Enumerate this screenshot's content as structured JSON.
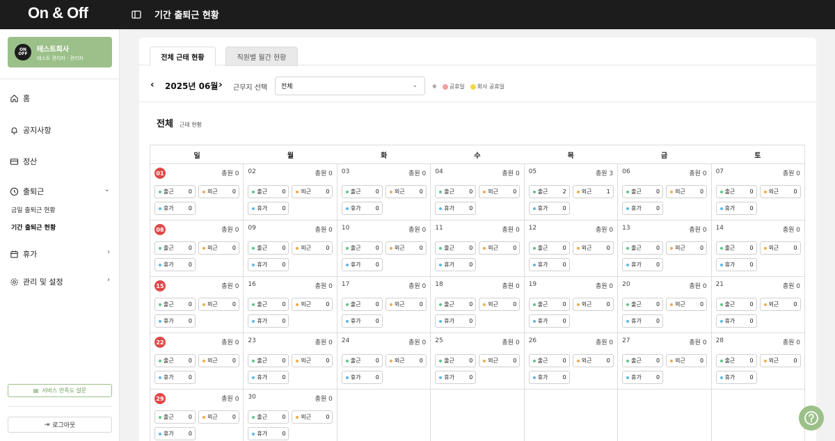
{
  "app": {
    "logo": "On & Off",
    "page_title": "기간 출퇴근 현황"
  },
  "sidebar": {
    "company": {
      "logo_text": "ON OFF",
      "name": "테스트회사",
      "sub": "테스트 관리자 · 관리자",
      "color": "#9bc089"
    },
    "items": [
      {
        "label": "홈",
        "icon": "home-icon"
      },
      {
        "label": "공지사항",
        "icon": "bell-icon"
      },
      {
        "label": "정산",
        "icon": "card-icon"
      },
      {
        "label": "출퇴근",
        "icon": "clock-icon"
      },
      {
        "label": "휴가",
        "icon": "calendar-icon"
      },
      {
        "label": "관리 및 설정",
        "icon": "gear-icon"
      }
    ],
    "sub_items": [
      {
        "label": "금일 출퇴근 현황"
      },
      {
        "label": "기간 출퇴근 현황"
      }
    ],
    "survey_label": "서비스 만족도 설문",
    "logout_label": "로그아웃"
  },
  "tabs": [
    {
      "label": "전체 근태 현황"
    },
    {
      "label": "직원별 월간 현황"
    }
  ],
  "toolbar": {
    "month": "2025년 06월",
    "site_label": "근무지 선택",
    "site_value": "전체",
    "legend_prefix": "※",
    "legend_public": "공휴일",
    "legend_company": "회사 공휴일",
    "public_color": "#f0a0a0",
    "company_color": "#f2d94a"
  },
  "section": {
    "title": "전체",
    "sub": "근태 현황"
  },
  "calendar": {
    "weekdays": [
      "일",
      "월",
      "화",
      "수",
      "목",
      "금",
      "토"
    ],
    "labels": {
      "total": "총원",
      "in": "출근",
      "out": "외근",
      "leave": "휴가"
    },
    "colors": {
      "in": "#5cc48a",
      "out": "#f2a94a",
      "leave": "#5bb8e8"
    },
    "days": [
      {
        "date": "01",
        "total": "0",
        "in": "0",
        "out": "0",
        "leave": "0",
        "holiday": true
      },
      {
        "date": "02",
        "total": "0",
        "in": "0",
        "out": "0",
        "leave": "0"
      },
      {
        "date": "03",
        "total": "0",
        "in": "0",
        "out": "0",
        "leave": "0"
      },
      {
        "date": "04",
        "total": "0",
        "in": "0",
        "out": "0",
        "leave": "0"
      },
      {
        "date": "05",
        "total": "3",
        "in": "2",
        "out": "1",
        "leave": "0"
      },
      {
        "date": "06",
        "total": "0",
        "in": "0",
        "out": "0",
        "leave": "0"
      },
      {
        "date": "07",
        "total": "0",
        "in": "0",
        "out": "0",
        "leave": "0"
      },
      {
        "date": "08",
        "total": "0",
        "in": "0",
        "out": "0",
        "leave": "0",
        "holiday": true
      },
      {
        "date": "09",
        "total": "0",
        "in": "0",
        "out": "0",
        "leave": "0"
      },
      {
        "date": "10",
        "total": "0",
        "in": "0",
        "out": "0",
        "leave": "0"
      },
      {
        "date": "11",
        "total": "0",
        "in": "0",
        "out": "0",
        "leave": "0"
      },
      {
        "date": "12",
        "total": "0",
        "in": "0",
        "out": "0",
        "leave": "0"
      },
      {
        "date": "13",
        "total": "0",
        "in": "0",
        "out": "0",
        "leave": "0"
      },
      {
        "date": "14",
        "total": "0",
        "in": "0",
        "out": "0",
        "leave": "0"
      },
      {
        "date": "15",
        "total": "0",
        "in": "0",
        "out": "0",
        "leave": "0",
        "holiday": true
      },
      {
        "date": "16",
        "total": "0",
        "in": "0",
        "out": "0",
        "leave": "0"
      },
      {
        "date": "17",
        "total": "0",
        "in": "0",
        "out": "0",
        "leave": "0"
      },
      {
        "date": "18",
        "total": "0",
        "in": "0",
        "out": "0",
        "leave": "0"
      },
      {
        "date": "19",
        "total": "0",
        "in": "0",
        "out": "0",
        "leave": "0"
      },
      {
        "date": "20",
        "total": "0",
        "in": "0",
        "out": "0",
        "leave": "0"
      },
      {
        "date": "21",
        "total": "0",
        "in": "0",
        "out": "0",
        "leave": "0"
      },
      {
        "date": "22",
        "total": "0",
        "in": "0",
        "out": "0",
        "leave": "0",
        "holiday": true
      },
      {
        "date": "23",
        "total": "0",
        "in": "0",
        "out": "0",
        "leave": "0"
      },
      {
        "date": "24",
        "total": "0",
        "in": "0",
        "out": "0",
        "leave": "0"
      },
      {
        "date": "25",
        "total": "0",
        "in": "0",
        "out": "0",
        "leave": "0"
      },
      {
        "date": "26",
        "total": "0",
        "in": "0",
        "out": "0",
        "leave": "0"
      },
      {
        "date": "27",
        "total": "0",
        "in": "0",
        "out": "0",
        "leave": "0"
      },
      {
        "date": "28",
        "total": "0",
        "in": "0",
        "out": "0",
        "leave": "0"
      },
      {
        "date": "29",
        "total": "0",
        "in": "0",
        "out": "0",
        "leave": "0",
        "holiday": true
      },
      {
        "date": "30",
        "total": "0",
        "in": "0",
        "out": "0",
        "leave": "0"
      }
    ]
  }
}
